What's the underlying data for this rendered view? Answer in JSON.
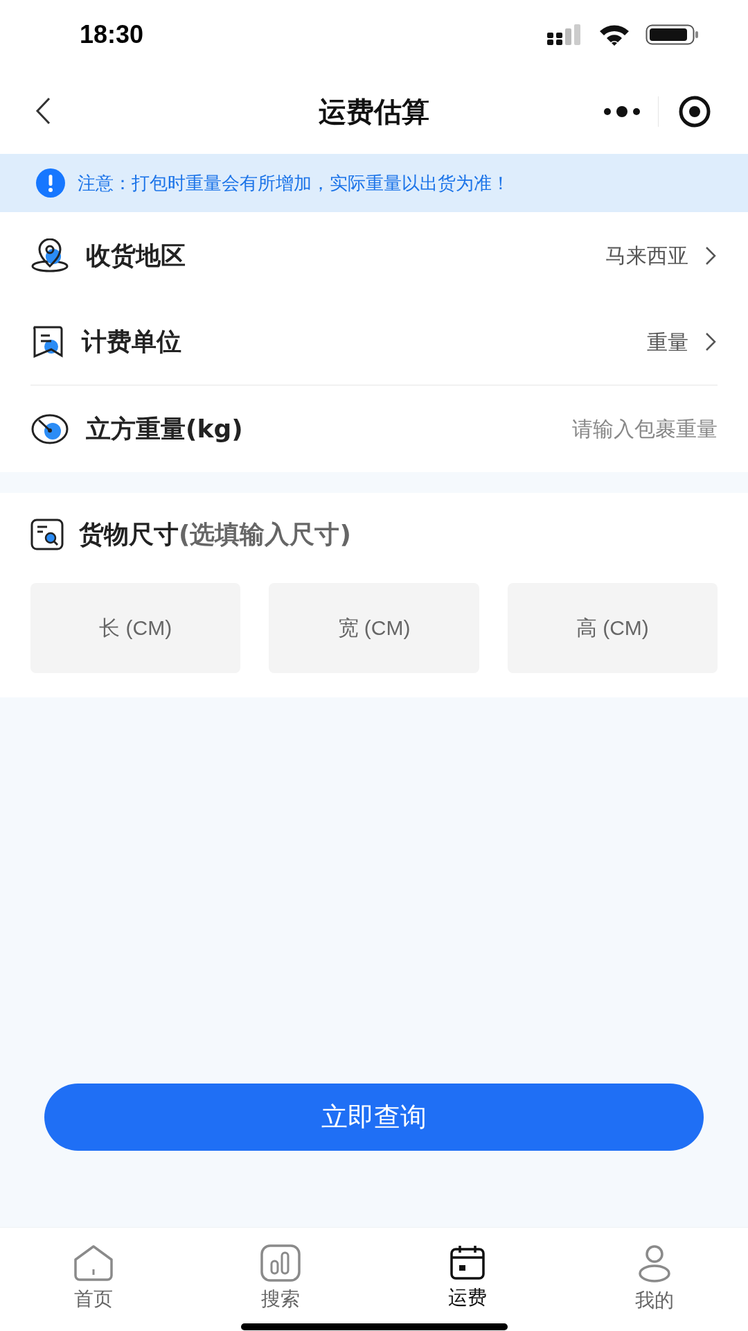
{
  "status_bar": {
    "time": "18:30"
  },
  "nav": {
    "title": "运费估算"
  },
  "notice": {
    "text": "注意：打包时重量会有所增加，实际重量以出货为准！"
  },
  "rows": [
    {
      "kind": "select",
      "label": "收货地区",
      "value": "马来西亚"
    },
    {
      "kind": "select",
      "label": "计费单位",
      "value": "重量"
    },
    {
      "kind": "input",
      "label": "立方重量(kg)",
      "placeholder": "请输入包裹重量"
    }
  ],
  "dimensions": {
    "title": "货物尺寸",
    "hint": "(选填输入尺寸)",
    "fields": [
      {
        "placeholder": "长 (CM)"
      },
      {
        "placeholder": "宽 (CM)"
      },
      {
        "placeholder": "高 (CM)"
      }
    ]
  },
  "button": {
    "label": "立即查询"
  },
  "tabs": [
    {
      "label": "首页",
      "selected": false
    },
    {
      "label": "搜索",
      "selected": false
    },
    {
      "label": "运费",
      "selected": true
    },
    {
      "label": "我的",
      "selected": false
    }
  ]
}
